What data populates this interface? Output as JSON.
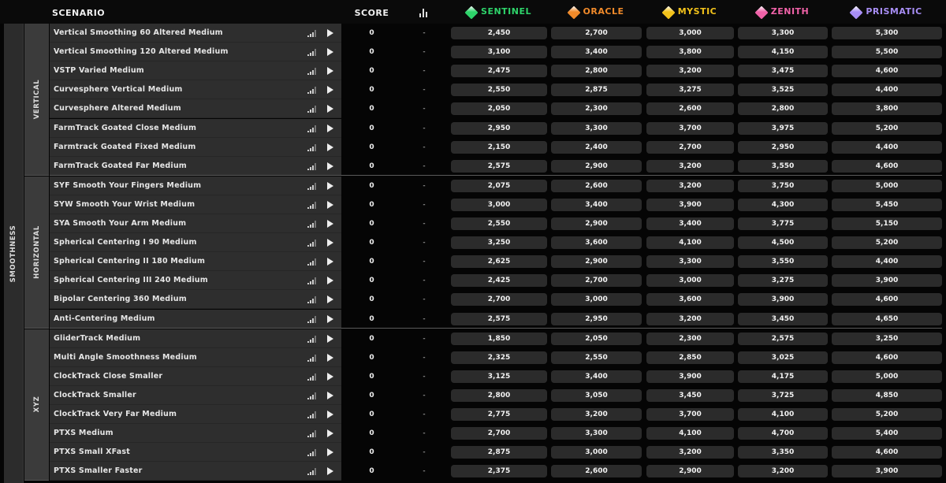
{
  "header": {
    "scenario": "SCENARIO",
    "score": "SCORE",
    "ranks": [
      {
        "name": "SENTINEL",
        "color": "#2ed36a"
      },
      {
        "name": "ORACLE",
        "color": "#f08a2a"
      },
      {
        "name": "MYSTIC",
        "color": "#f2c21b"
      },
      {
        "name": "ZENITH",
        "color": "#f062a8"
      },
      {
        "name": "PRISMATIC",
        "color": "#a88ef5"
      }
    ]
  },
  "category": "SMOOTHNESS",
  "groups": [
    {
      "name": "VERTICAL",
      "rows": [
        {
          "name": "Vertical Smoothing 60 Altered Medium",
          "score": "0",
          "rank": "-",
          "thresholds": [
            "2,450",
            "2,700",
            "3,000",
            "3,300",
            "5,300"
          ]
        },
        {
          "name": "Vertical Smoothing 120 Altered Medium",
          "score": "0",
          "rank": "-",
          "thresholds": [
            "3,100",
            "3,400",
            "3,800",
            "4,150",
            "5,500"
          ]
        },
        {
          "name": "VSTP Varied Medium",
          "score": "0",
          "rank": "-",
          "thresholds": [
            "2,475",
            "2,800",
            "3,200",
            "3,475",
            "4,600"
          ]
        },
        {
          "name": "Curvesphere Vertical Medium",
          "score": "0",
          "rank": "-",
          "thresholds": [
            "2,550",
            "2,875",
            "3,275",
            "3,525",
            "4,400"
          ]
        },
        {
          "name": "Curvesphere Altered Medium",
          "score": "0",
          "rank": "-",
          "thresholds": [
            "2,050",
            "2,300",
            "2,600",
            "2,800",
            "3,800"
          ]
        },
        {
          "name": "FarmTrack Goated Close Medium",
          "score": "0",
          "rank": "-",
          "thresholds": [
            "2,950",
            "3,300",
            "3,700",
            "3,975",
            "5,200"
          ]
        },
        {
          "name": "Farmtrack Goated Fixed Medium",
          "score": "0",
          "rank": "-",
          "thresholds": [
            "2,150",
            "2,400",
            "2,700",
            "2,950",
            "4,400"
          ]
        },
        {
          "name": "FarmTrack Goated Far Medium",
          "score": "0",
          "rank": "-",
          "thresholds": [
            "2,575",
            "2,900",
            "3,200",
            "3,550",
            "4,600"
          ]
        }
      ]
    },
    {
      "name": "HORIZONTAL",
      "rows": [
        {
          "name": "SYF Smooth Your Fingers Medium",
          "score": "0",
          "rank": "-",
          "thresholds": [
            "2,075",
            "2,600",
            "3,200",
            "3,750",
            "5,000"
          ]
        },
        {
          "name": "SYW Smooth Your Wrist Medium",
          "score": "0",
          "rank": "-",
          "thresholds": [
            "3,000",
            "3,400",
            "3,900",
            "4,300",
            "5,450"
          ]
        },
        {
          "name": "SYA Smooth Your Arm Medium",
          "score": "0",
          "rank": "-",
          "thresholds": [
            "2,550",
            "2,900",
            "3,400",
            "3,775",
            "5,150"
          ]
        },
        {
          "name": "Spherical Centering I 90 Medium",
          "score": "0",
          "rank": "-",
          "thresholds": [
            "3,250",
            "3,600",
            "4,100",
            "4,500",
            "5,200"
          ]
        },
        {
          "name": "Spherical Centering II 180 Medium",
          "score": "0",
          "rank": "-",
          "thresholds": [
            "2,625",
            "2,900",
            "3,300",
            "3,550",
            "4,400"
          ]
        },
        {
          "name": "Spherical Centering III 240 Medium",
          "score": "0",
          "rank": "-",
          "thresholds": [
            "2,425",
            "2,700",
            "3,000",
            "3,275",
            "3,900"
          ]
        },
        {
          "name": "Bipolar Centering 360 Medium",
          "score": "0",
          "rank": "-",
          "thresholds": [
            "2,700",
            "3,000",
            "3,600",
            "3,900",
            "4,600"
          ]
        },
        {
          "name": "Anti-Centering Medium",
          "score": "0",
          "rank": "-",
          "thresholds": [
            "2,575",
            "2,950",
            "3,200",
            "3,450",
            "4,650"
          ]
        }
      ]
    },
    {
      "name": "XYZ",
      "rows": [
        {
          "name": "GliderTrack Medium",
          "score": "0",
          "rank": "-",
          "thresholds": [
            "1,850",
            "2,050",
            "2,300",
            "2,575",
            "3,250"
          ]
        },
        {
          "name": "Multi Angle Smoothness Medium",
          "score": "0",
          "rank": "-",
          "thresholds": [
            "2,325",
            "2,550",
            "2,850",
            "3,025",
            "4,600"
          ]
        },
        {
          "name": "ClockTrack Close Smaller",
          "score": "0",
          "rank": "-",
          "thresholds": [
            "3,125",
            "3,400",
            "3,900",
            "4,175",
            "5,000"
          ]
        },
        {
          "name": "ClockTrack Smaller",
          "score": "0",
          "rank": "-",
          "thresholds": [
            "2,800",
            "3,050",
            "3,450",
            "3,725",
            "4,850"
          ]
        },
        {
          "name": "ClockTrack Very Far Medium",
          "score": "0",
          "rank": "-",
          "thresholds": [
            "2,775",
            "3,200",
            "3,700",
            "4,100",
            "5,200"
          ]
        },
        {
          "name": "PTXS Medium",
          "score": "0",
          "rank": "-",
          "thresholds": [
            "2,700",
            "3,300",
            "4,100",
            "4,700",
            "5,400"
          ]
        },
        {
          "name": "PTXS Small XFast",
          "score": "0",
          "rank": "-",
          "thresholds": [
            "2,875",
            "3,000",
            "3,200",
            "3,350",
            "4,600"
          ]
        },
        {
          "name": "PTXS Smaller Faster",
          "score": "0",
          "rank": "-",
          "thresholds": [
            "2,375",
            "2,600",
            "2,900",
            "3,200",
            "3,900"
          ]
        }
      ]
    }
  ]
}
